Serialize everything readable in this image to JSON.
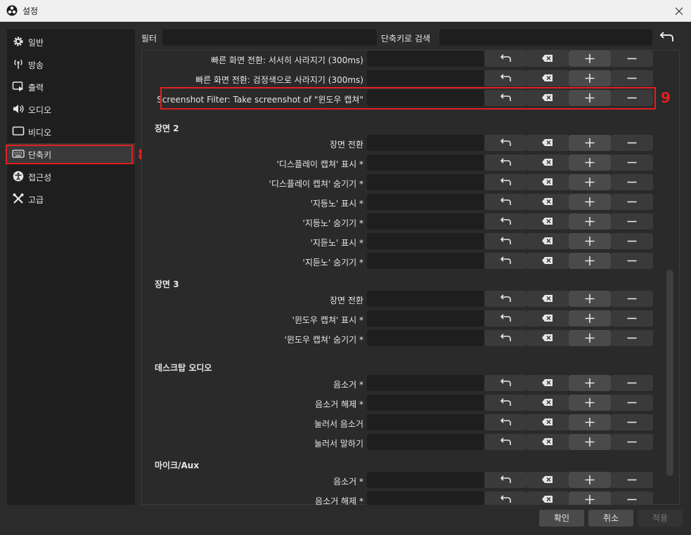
{
  "window": {
    "title": "설정"
  },
  "sidebar": {
    "items": [
      {
        "label": "일반",
        "icon": "gear-icon"
      },
      {
        "label": "방송",
        "icon": "antenna-icon"
      },
      {
        "label": "출력",
        "icon": "output-icon"
      },
      {
        "label": "오디오",
        "icon": "speaker-icon"
      },
      {
        "label": "비디오",
        "icon": "monitor-icon"
      },
      {
        "label": "단축키",
        "icon": "keyboard-icon"
      },
      {
        "label": "접근성",
        "icon": "accessibility-icon"
      },
      {
        "label": "고급",
        "icon": "tools-icon"
      }
    ],
    "active_index": 5
  },
  "annotations": {
    "sidebar_marker": "8",
    "row_marker": "9"
  },
  "filter": {
    "label": "필터",
    "value": ""
  },
  "search": {
    "label": "단축키로 검색",
    "value": ""
  },
  "rows": [
    {
      "label": "빠른 화면 전환: 서서히 사라지기 (300ms)"
    },
    {
      "label": "빠른 화면 전환: 검정색으로 사라지기 (300ms)"
    },
    {
      "label": "Screenshot Filter: Take screenshot of \"윈도우 캡쳐\""
    }
  ],
  "sections": [
    {
      "title": "장면 2",
      "rows": [
        {
          "label": "장면 전환"
        },
        {
          "label": "'디스플레이 캡쳐' 표시 *"
        },
        {
          "label": "'디스플레이 캡쳐' 숨기기 *"
        },
        {
          "label": "'지등노' 표시 *"
        },
        {
          "label": "'지등노' 숨기기 *"
        },
        {
          "label": "'지듣노' 표시 *"
        },
        {
          "label": "'지듣노' 숨기기 *"
        }
      ]
    },
    {
      "title": "장면 3",
      "rows": [
        {
          "label": "장면 전환"
        },
        {
          "label": "'윈도우 캡쳐' 표시 *"
        },
        {
          "label": "'윈도우 캡쳐' 숨기기 *"
        }
      ]
    },
    {
      "title": "데스크탑 오디오",
      "rows": [
        {
          "label": "음소거 *"
        },
        {
          "label": "음소거 해제 *"
        },
        {
          "label": "눌러서 음소거"
        },
        {
          "label": "눌러서 말하기"
        }
      ]
    },
    {
      "title": "마이크/Aux",
      "rows": [
        {
          "label": "음소거 *"
        },
        {
          "label": "음소거 해제 *"
        }
      ]
    }
  ],
  "row_buttons": [
    "undo-icon",
    "backspace-clear-icon",
    "plus-icon",
    "minus-icon"
  ],
  "footer": {
    "ok": "확인",
    "cancel": "취소",
    "apply": "적용"
  },
  "colors": {
    "highlight": "#e02020",
    "background": "#2b2b2b",
    "input": "#1e1e1e"
  }
}
